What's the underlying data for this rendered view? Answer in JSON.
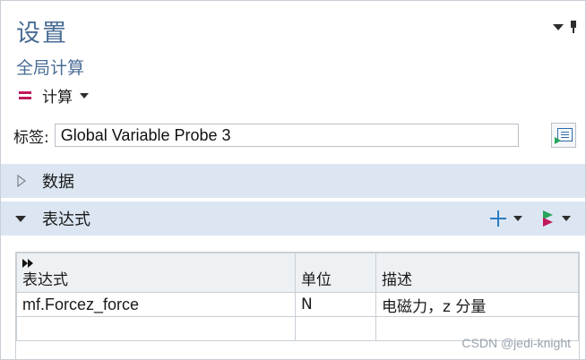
{
  "header": {
    "title": "设置",
    "subtitle": "全局计算"
  },
  "toolbar": {
    "compute_label": "计算"
  },
  "label_field": {
    "label": "标签:",
    "value": "Global Variable Probe 3"
  },
  "sections": {
    "data": {
      "label": "数据",
      "expanded": false
    },
    "expressions": {
      "label": "表达式",
      "expanded": true
    }
  },
  "table": {
    "headers": [
      "表达式",
      "单位",
      "描述"
    ],
    "rows": [
      [
        "mf.Forcez_force",
        "N",
        "电磁力，z 分量"
      ],
      [
        "",
        "",
        ""
      ]
    ]
  },
  "watermark": "CSDN @jedi-knight",
  "colors": {
    "title": "#4a6d95",
    "section_bg": "#dbe6f2",
    "accent_magenta": "#c2185b",
    "accent_green": "#27a35a",
    "accent_blue": "#2b7bbf"
  }
}
